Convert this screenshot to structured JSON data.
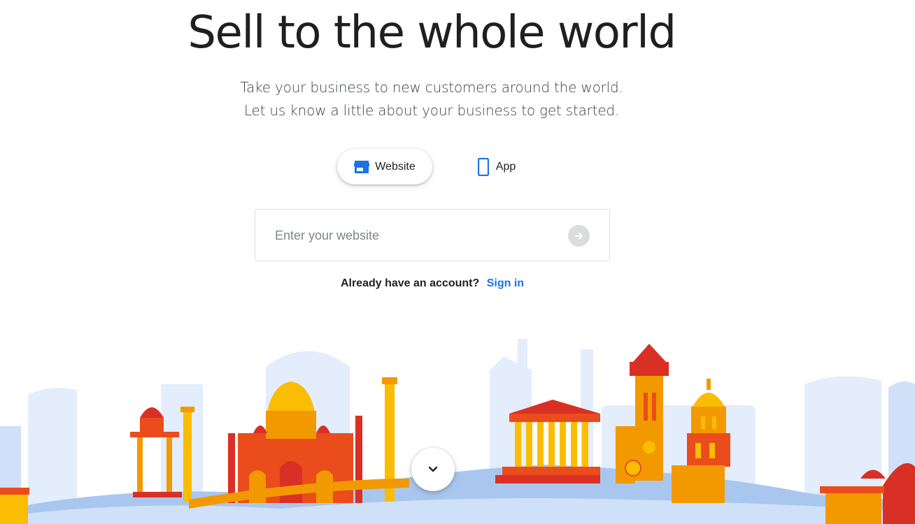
{
  "hero": {
    "title": "Sell to the whole world",
    "subtitle_line1": "Take your business to new customers around the world.",
    "subtitle_line2": "Let us know a little about your business to get started."
  },
  "business_type": {
    "options": [
      {
        "label": "Website",
        "icon": "storefront-icon",
        "selected": true
      },
      {
        "label": "App",
        "icon": "smartphone-icon",
        "selected": false
      }
    ]
  },
  "url_form": {
    "placeholder": "Enter your website",
    "value": "",
    "submit_icon": "arrow-forward-icon"
  },
  "account": {
    "prompt": "Already have an account?",
    "signin_label": "Sign in"
  },
  "illustration": {
    "name": "world-landmarks-skyline",
    "colors": {
      "orange": "#f29900",
      "deep_orange": "#ea4c1c",
      "red": "#d93025",
      "yellow": "#fbbc04",
      "light_blue": "#d2e3fc",
      "blue": "#aecbfa"
    }
  },
  "scroll": {
    "icon": "chevron-down-icon"
  },
  "colors": {
    "accent": "#1a73e8",
    "title": "#1f1f1f",
    "text": "#3c4043"
  }
}
